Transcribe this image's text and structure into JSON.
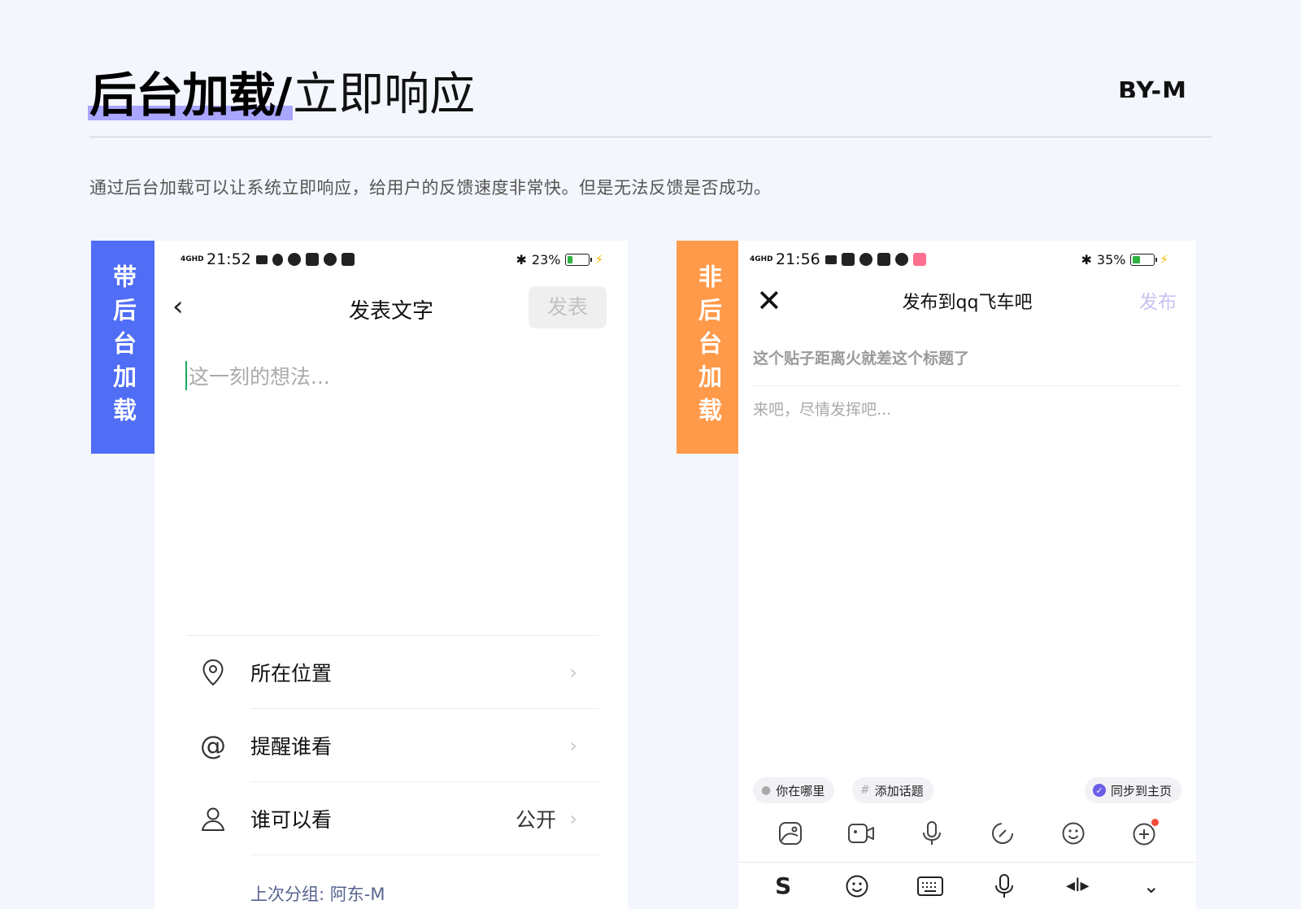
{
  "header": {
    "title_bold": "后台加载",
    "title_sep": "/",
    "title_light": "立即响应",
    "brand": "BY-M",
    "description": "通过后台加载可以让系统立即响应，给用户的反馈速度非常快。但是无法反馈是否成功。"
  },
  "tags": {
    "left": "带后台加载",
    "right": "非后台加载"
  },
  "colors": {
    "accent_blue": "#4f6df5",
    "accent_orange": "#ff9a4a",
    "highlight": "#a9a6ff"
  },
  "left_phone": {
    "status": {
      "signal": "4GHD",
      "time": "21:52",
      "battery": "23%"
    },
    "nav": {
      "back_icon": "chevron-left-icon",
      "title": "发表文字",
      "post_button": "发表"
    },
    "placeholder": "这一刻的想法...",
    "options": [
      {
        "icon": "location-pin-icon",
        "label": "所在位置",
        "value": ""
      },
      {
        "icon": "at-sign-icon",
        "label": "提醒谁看",
        "value": ""
      },
      {
        "icon": "person-icon",
        "label": "谁可以看",
        "value": "公开"
      }
    ],
    "last_group": "上次分组: 阿东-M"
  },
  "right_phone": {
    "status": {
      "signal": "4GHD",
      "time": "21:56",
      "battery": "35%"
    },
    "nav": {
      "close_icon": "close-icon",
      "title": "发布到qq飞车吧",
      "post_button": "发布"
    },
    "title_placeholder": "这个贴子距离火就差这个标题了",
    "body_placeholder": "来吧，尽情发挥吧...",
    "chips": {
      "location": "你在哪里",
      "topic": "添加话题",
      "sync": "同步到主页"
    }
  }
}
